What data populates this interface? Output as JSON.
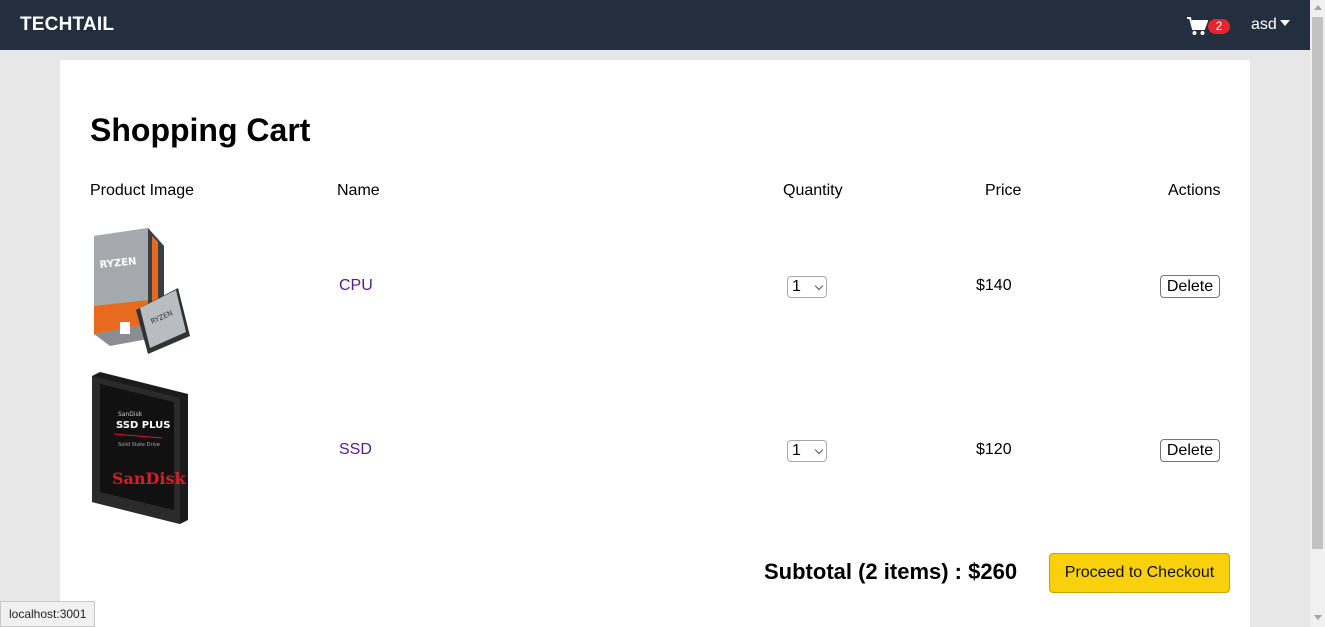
{
  "navbar": {
    "brand": "TECHTAIL",
    "cart_count": "2",
    "user_name": "asd"
  },
  "page": {
    "title": "Shopping Cart"
  },
  "table": {
    "headers": [
      "Product Image",
      "Name",
      "Quantity",
      "Price",
      "Actions"
    ],
    "rows": [
      {
        "name": "CPU",
        "quantity": "1",
        "price": "$140",
        "action": "Delete",
        "image_icon": "ryzen-cpu-box-image"
      },
      {
        "name": "SSD",
        "quantity": "1",
        "price": "$120",
        "action": "Delete",
        "image_icon": "sandisk-ssd-image"
      }
    ]
  },
  "summary": {
    "subtotal": "Subtotal (2 items) : $260",
    "checkout_label": "Proceed to Checkout"
  },
  "status_bar": {
    "url": "localhost:3001"
  },
  "colors": {
    "navbar_bg": "#232f3e",
    "badge_bg": "#e3262b",
    "checkout_bg": "#f8d10c",
    "link": "#551a8b"
  }
}
